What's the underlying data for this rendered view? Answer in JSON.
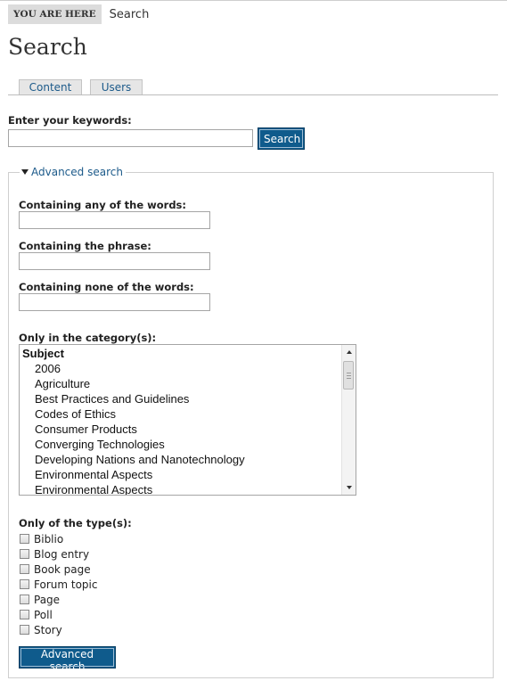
{
  "breadcrumb": {
    "tag": "YOU ARE HERE",
    "current": "Search"
  },
  "page_title": "Search",
  "tabs": [
    {
      "label": "Content"
    },
    {
      "label": "Users"
    }
  ],
  "keywords": {
    "label": "Enter your keywords:",
    "value": "",
    "button": "Search"
  },
  "advanced": {
    "legend": "Advanced search",
    "any_words_label": "Containing any of the words:",
    "phrase_label": "Containing the phrase:",
    "none_words_label": "Containing none of the words:",
    "category_label": "Only in the category(s):",
    "category_group": "Subject",
    "categories": [
      "2006",
      "Agriculture",
      "Best Practices and Guidelines",
      "Codes of Ethics",
      "Consumer Products",
      "Converging Technologies",
      "Developing Nations and Nanotechnology",
      "Environmental Aspects",
      "Environmental Aspects"
    ],
    "type_label": "Only of the type(s):",
    "types": [
      {
        "label": "Biblio",
        "checked": false
      },
      {
        "label": "Blog entry",
        "checked": false
      },
      {
        "label": "Book page",
        "checked": false
      },
      {
        "label": "Forum topic",
        "checked": false
      },
      {
        "label": "Page",
        "checked": false
      },
      {
        "label": "Poll",
        "checked": false
      },
      {
        "label": "Story",
        "checked": false
      }
    ],
    "button": "Advanced search"
  },
  "colors": {
    "accent": "#0f5b8c",
    "link": "#1c5a8a"
  }
}
